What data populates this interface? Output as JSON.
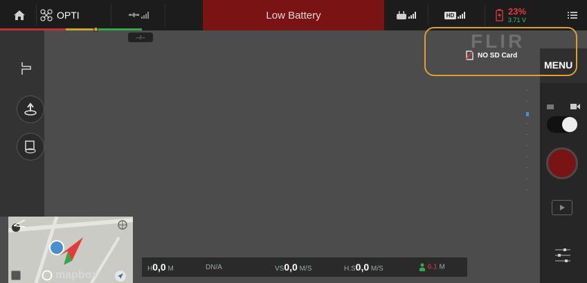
{
  "topbar": {
    "mode_label": "OPTI",
    "battery_alert": "Low Battery",
    "battery_percent": "23%",
    "battery_voltage": "3.71 V",
    "hd_badge": "HD",
    "rc_badge": "RC",
    "home_icon": "home-icon",
    "menu_icon": "list-menu-icon"
  },
  "overlay": {
    "brand": "FLIR",
    "sd_status": "NO SD Card",
    "menu_label": "MENU"
  },
  "route": {
    "rth_label": "--/--"
  },
  "telemetry": {
    "h_label": "H",
    "h_value": "0,0",
    "h_unit": "M",
    "d_label": "D",
    "d_value": "N/A",
    "vs_label": "VS",
    "vs_value": "0,0",
    "vs_unit": "M/S",
    "hs_label": "H.S",
    "hs_value": "0,0",
    "hs_unit": "M/S",
    "dist_value": "6.1",
    "dist_unit": "M"
  },
  "map": {
    "brand": "mapbox"
  },
  "colors": {
    "alert_red": "#7a1414",
    "accent_orange": "#e0a030",
    "battery_red": "#e23b3b",
    "voltage_green": "#3ec46d"
  }
}
